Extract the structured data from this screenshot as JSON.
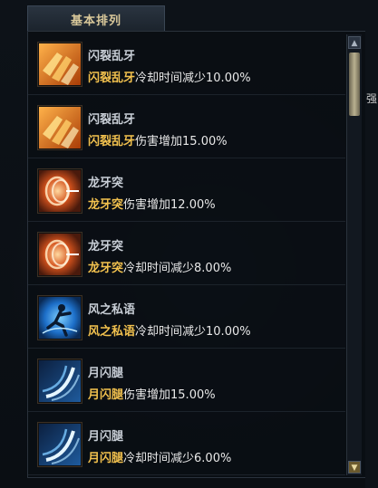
{
  "tab": {
    "label": "基本排列"
  },
  "edge_text": "强",
  "skills": [
    {
      "title": "闪裂乱牙",
      "skill_name": "闪裂乱牙",
      "effect": "冷却时间减少10.00%",
      "icon": "claw-strike-icon"
    },
    {
      "title": "闪裂乱牙",
      "skill_name": "闪裂乱牙",
      "effect": "伤害增加15.00%",
      "icon": "claw-strike-icon"
    },
    {
      "title": "龙牙突",
      "skill_name": "龙牙突",
      "effect": "伤害增加12.00%",
      "icon": "dragon-fang-icon"
    },
    {
      "title": "龙牙突",
      "skill_name": "龙牙突",
      "effect": "冷却时间减少8.00%",
      "icon": "dragon-fang-icon"
    },
    {
      "title": "风之私语",
      "skill_name": "风之私语",
      "effect": "冷却时间减少10.00%",
      "icon": "wind-whisper-icon"
    },
    {
      "title": "月闪腿",
      "skill_name": "月闪腿",
      "effect": "伤害增加15.00%",
      "icon": "moon-kick-icon"
    },
    {
      "title": "月闪腿",
      "skill_name": "月闪腿",
      "effect": "冷却时间减少6.00%",
      "icon": "moon-kick-icon"
    }
  ],
  "colors": {
    "skill_highlight": "#f2c14e",
    "tab_text": "#d9c89a"
  }
}
